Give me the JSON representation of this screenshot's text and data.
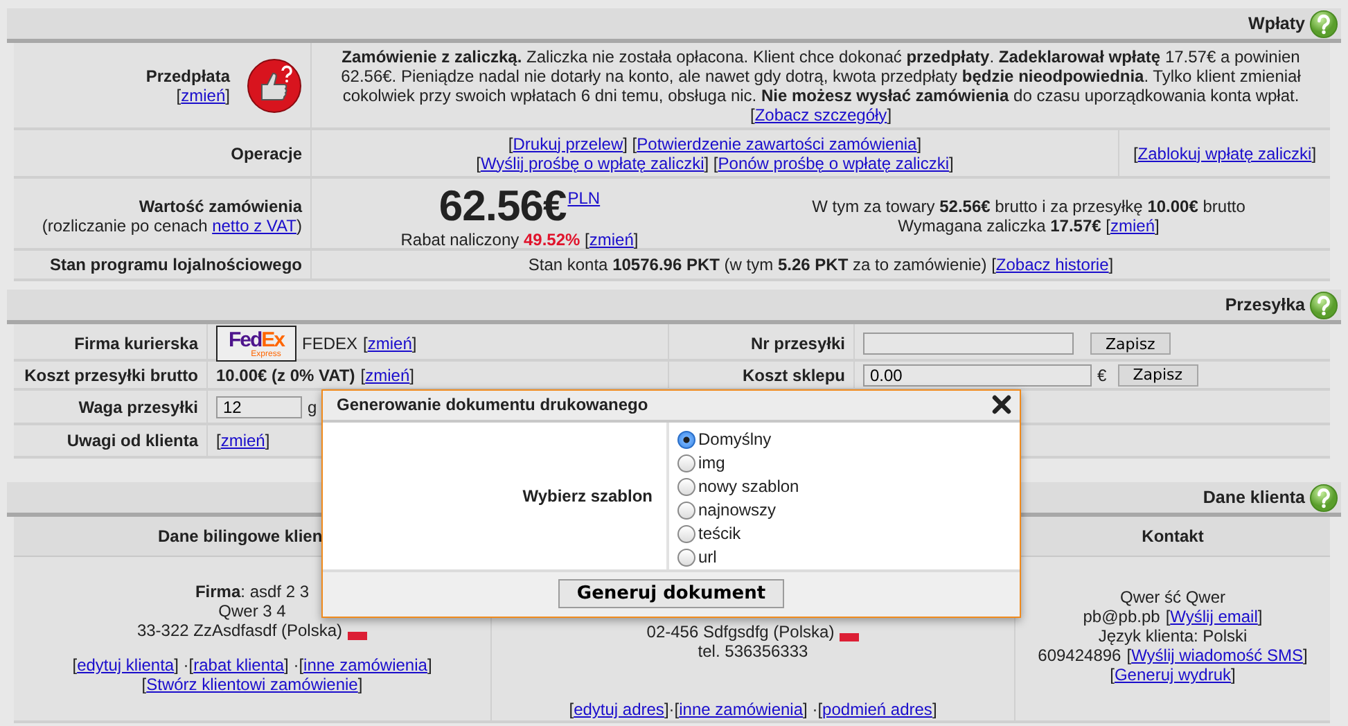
{
  "payments": {
    "title": "Wpłaty",
    "prepayment": {
      "label": "Przedpłata",
      "link": "[zmień]",
      "message": "**Zamówienie z zaliczką.** Zaliczka nie została opłacona. Klient chce dokonać **przedpłaty**. **Zadeklarował wpłatę** 17.57€ a powinien 62.56€. Pieniądze nadal nie dotarły na konto, ale nawet gdy dotrą, kwota przedpłaty **będzie nieodpowiednia**. Tylko klient zmieniał cokolwiek przy swoich wpłatach 6 dni temu, obsługa nic. **Nie możesz wysłać zamówienia** do czasu uporządkowania konta wpłat.",
      "details_link": "[Zobacz szczegóły]"
    },
    "operations": {
      "label": "Operacje",
      "link_lines": [
        [
          "[Drukuj przelew]",
          "[Potwierdzenie zawartości zamówienia]"
        ],
        [
          "[Wyślij prośbę o wpłatę zaliczki]",
          "[Ponów prośbę o wpłatę zaliczki]"
        ]
      ],
      "side_link": "[Zablokuj wpłatę zaliczki]"
    },
    "order_value": {
      "label": "Wartość zamówienia",
      "note_before": "(rozliczanie po cenach ",
      "note_link": "netto z VAT",
      "note_after": ")",
      "amount": "62.56€",
      "currency_link": "PLN",
      "discount_label": "Rabat naliczony ",
      "discount": "49.52%",
      "discount_link": "[zmień]",
      "breakdown": "W tym za towary **52.56€** brutto i za przesyłkę **10.00€** brutto",
      "deposit": "Wymagana zaliczka **17.57€** ",
      "deposit_link": "[zmień]"
    },
    "loyalty": {
      "label": "Stan programu lojalnościowego",
      "text": "Stan konta **10576.96 PKT** (w tym **5.26 PKT** za to zamówienie) ",
      "link": "[Zobacz historie]"
    }
  },
  "shipping": {
    "title": "Przesyłka",
    "courier": {
      "label": "Firma kurierska",
      "logo_parts": [
        "Fed",
        "Ex"
      ],
      "logo_sub": "Express",
      "name": "FEDEX",
      "link": "[zmień]"
    },
    "cost": {
      "label": "Koszt przesyłki brutto",
      "value": "10.00€ (z 0% VAT)",
      "link": "[zmień]"
    },
    "weight": {
      "label": "Waga przesyłki",
      "value": "12",
      "unit": "g"
    },
    "notes": {
      "label": "Uwagi od klienta",
      "link": "[zmień]"
    },
    "tracking": {
      "label": "Nr przesyłki",
      "button": "Zapisz"
    },
    "shop_cost": {
      "label": "Koszt sklepu",
      "value": "0.00",
      "unit": "€",
      "button": "Zapisz"
    }
  },
  "client": {
    "title": "Dane klienta",
    "billing": {
      "header": "Dane bilingowe klien",
      "lines": [
        {
          "text": "**Firma**: asdf 2 3",
          "flag": false
        },
        {
          "text": "Qwer 3 4",
          "flag": false
        },
        {
          "text": "33-322 ZzAsdfasdf (Polska)",
          "flag": true
        }
      ],
      "link_lines": [
        [
          "[edytuj klienta]",
          " ·",
          "[rabat klienta]",
          " ·",
          "[inne zamówienia]"
        ],
        [
          "[Stwórz klientowi zamówienie]"
        ]
      ]
    },
    "delivery": {
      "lines": [
        {
          "text": "02-456 Sdfgsdfg (Polska)",
          "flag": true
        },
        {
          "text": "tel. 536356333",
          "flag": false
        }
      ],
      "link_lines": [
        [
          "[edytuj adres]",
          "·",
          "[inne zamówienia]",
          " ·",
          "[podmień adres]"
        ]
      ]
    },
    "contact": {
      "header": "Kontakt",
      "lines": [
        {
          "text": "Qwer ść Qwer"
        },
        {
          "text": "pb@pb.pb ",
          "link": "[Wyślij email]"
        },
        {
          "text": "Język klienta: Polski"
        },
        {
          "text": "609424896 ",
          "link": "[Wyślij wiadomość SMS]"
        },
        {
          "link": "[Generuj wydruk]"
        }
      ]
    }
  },
  "dialog": {
    "title": "Generowanie dokumentu drukowanego",
    "label": "Wybierz szablon",
    "options": [
      {
        "label": "Domyślny",
        "selected": true
      },
      {
        "label": "img",
        "selected": false
      },
      {
        "label": "nowy szablon",
        "selected": false
      },
      {
        "label": "najnowszy",
        "selected": false
      },
      {
        "label": "teścik",
        "selected": false
      },
      {
        "label": "url",
        "selected": false
      }
    ],
    "button": "Generuj dokument"
  }
}
